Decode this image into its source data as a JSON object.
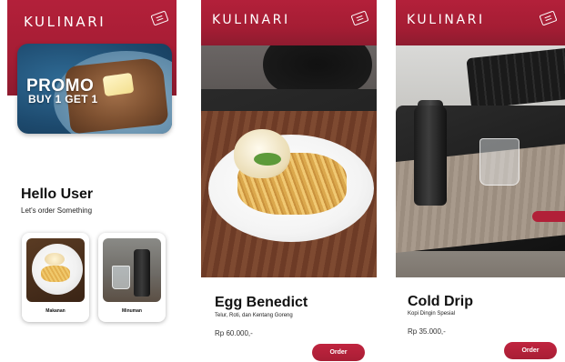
{
  "app": {
    "brand": "KULINARI"
  },
  "home": {
    "promo": {
      "title": "PROMO",
      "subtitle": "BUY 1 GET 1"
    },
    "greeting": "Hello User",
    "greeting_sub": "Let's order Something",
    "categories": [
      {
        "label": "Makanan"
      },
      {
        "label": "Minuman"
      }
    ]
  },
  "items": [
    {
      "title": "Egg Benedict",
      "description": "Telur, Roti, dan Kentang Goreng",
      "price": "Rp 60.000,-",
      "order_label": "Order"
    },
    {
      "title": "Cold Drip",
      "description": "Kopi Dingin Spesial",
      "price": "Rp 35.000,-",
      "order_label": "Order"
    }
  ],
  "colors": {
    "primary": "#a81e35",
    "text": "#111111",
    "background": "#ffffff"
  },
  "icons": {
    "header_right": "ticket-icon"
  }
}
